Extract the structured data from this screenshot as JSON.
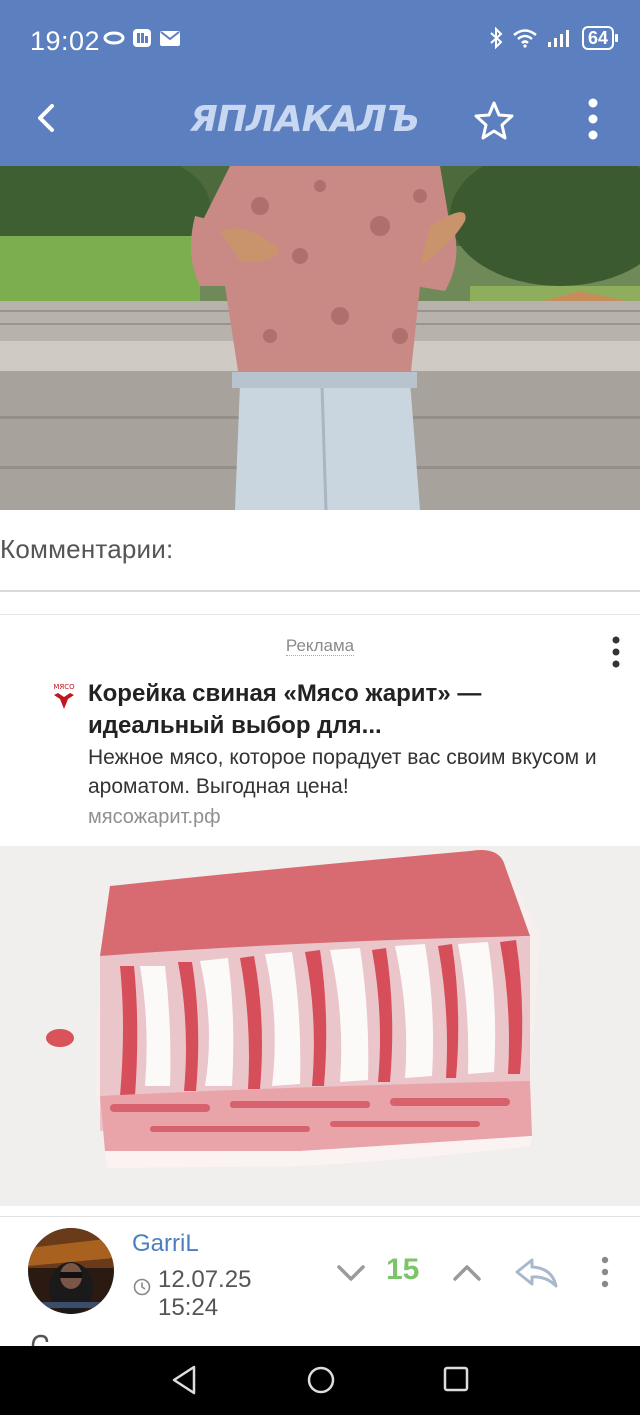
{
  "status_bar": {
    "time": "19:02",
    "battery": "64"
  },
  "app_bar": {
    "logo": "ЯПЛАКАЛЪ",
    "icons": [
      "back-arrow-icon",
      "star-icon",
      "more-vert-icon"
    ]
  },
  "comments": {
    "title": "Комментарии:"
  },
  "ad": {
    "label": "Реклама",
    "logo_text": "МЯСО",
    "title": "Корейка свиная «Мясо жарит» — идеальный выбор для...",
    "description": "Нежное мясо, которое порадует вас своим вкусом и ароматом. Выгодная цена!",
    "url": "мясожарит.рф"
  },
  "comment": {
    "username": "GarriL",
    "date": "12.07.25",
    "time": "15:24",
    "votes": "15",
    "icons": [
      "vote-down-icon",
      "vote-up-icon",
      "reply-icon",
      "more-vert-icon"
    ]
  },
  "colors": {
    "header": "#5b7fbf",
    "username": "#4a7fc1",
    "votes": "#7cc46a",
    "ad_accent": "#c0161d"
  }
}
